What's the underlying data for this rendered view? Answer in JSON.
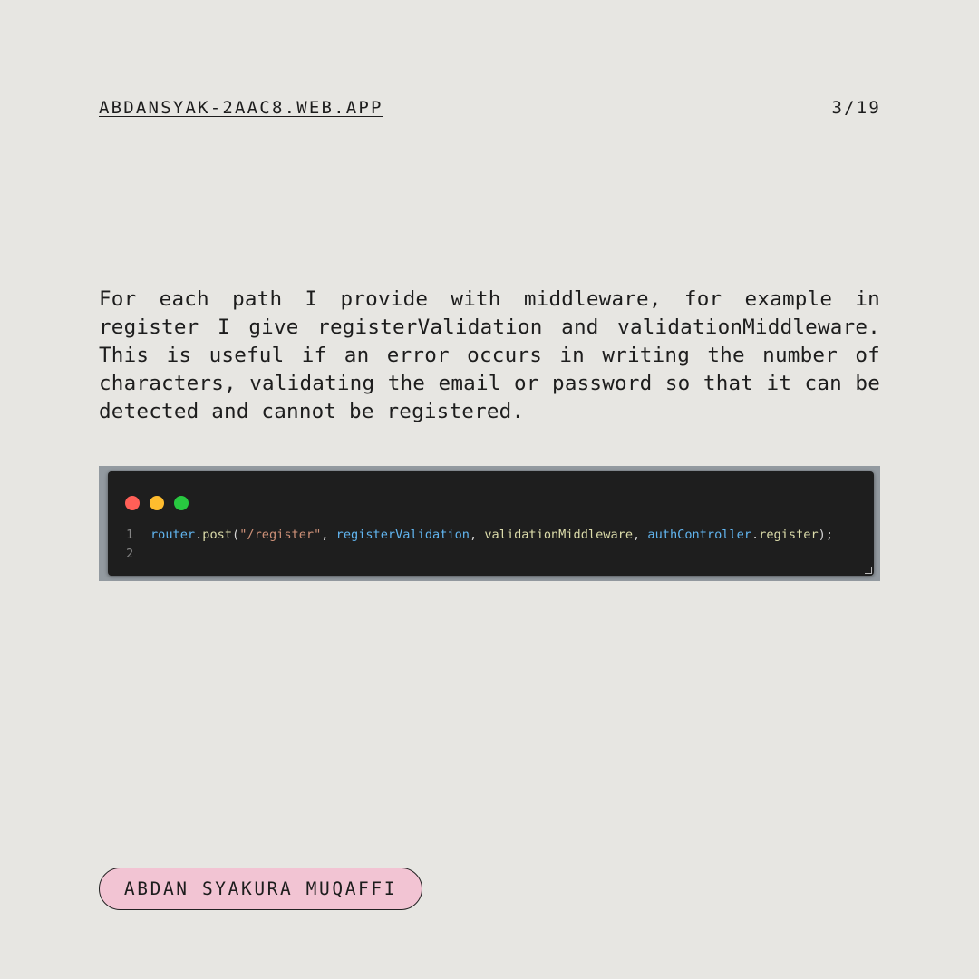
{
  "header": {
    "site": "ABDANSYAK-2AAC8.WEB.APP",
    "page": "3/19"
  },
  "body_text": "For each path I provide with middleware, for example in register I give registerValidation and validationMiddleware. This is useful if an error occurs in writing the number of characters, validating the email or password so that it can be detected and cannot be registered.",
  "code": {
    "line_numbers": [
      "1",
      "2"
    ],
    "tokens": {
      "router": "router",
      "dot1": ".",
      "post": "post",
      "paren_open": "(",
      "path": "\"/register\"",
      "sep1": ", ",
      "register_validation": "registerValidation",
      "sep2": ", ",
      "validation_middleware": "validationMiddleware",
      "sep3": ", ",
      "auth_controller": "authController",
      "dot2": ".",
      "register_fn": "register",
      "close": ");"
    }
  },
  "footer": {
    "author": "ABDAN SYAKURA MUQAFFI"
  },
  "colors": {
    "background": "#e7e6e2",
    "pill": "#f2c4d3",
    "code_bg": "#1e1e1e",
    "mac_red": "#ff5f57",
    "mac_yellow": "#febc2e",
    "mac_green": "#28c840"
  }
}
